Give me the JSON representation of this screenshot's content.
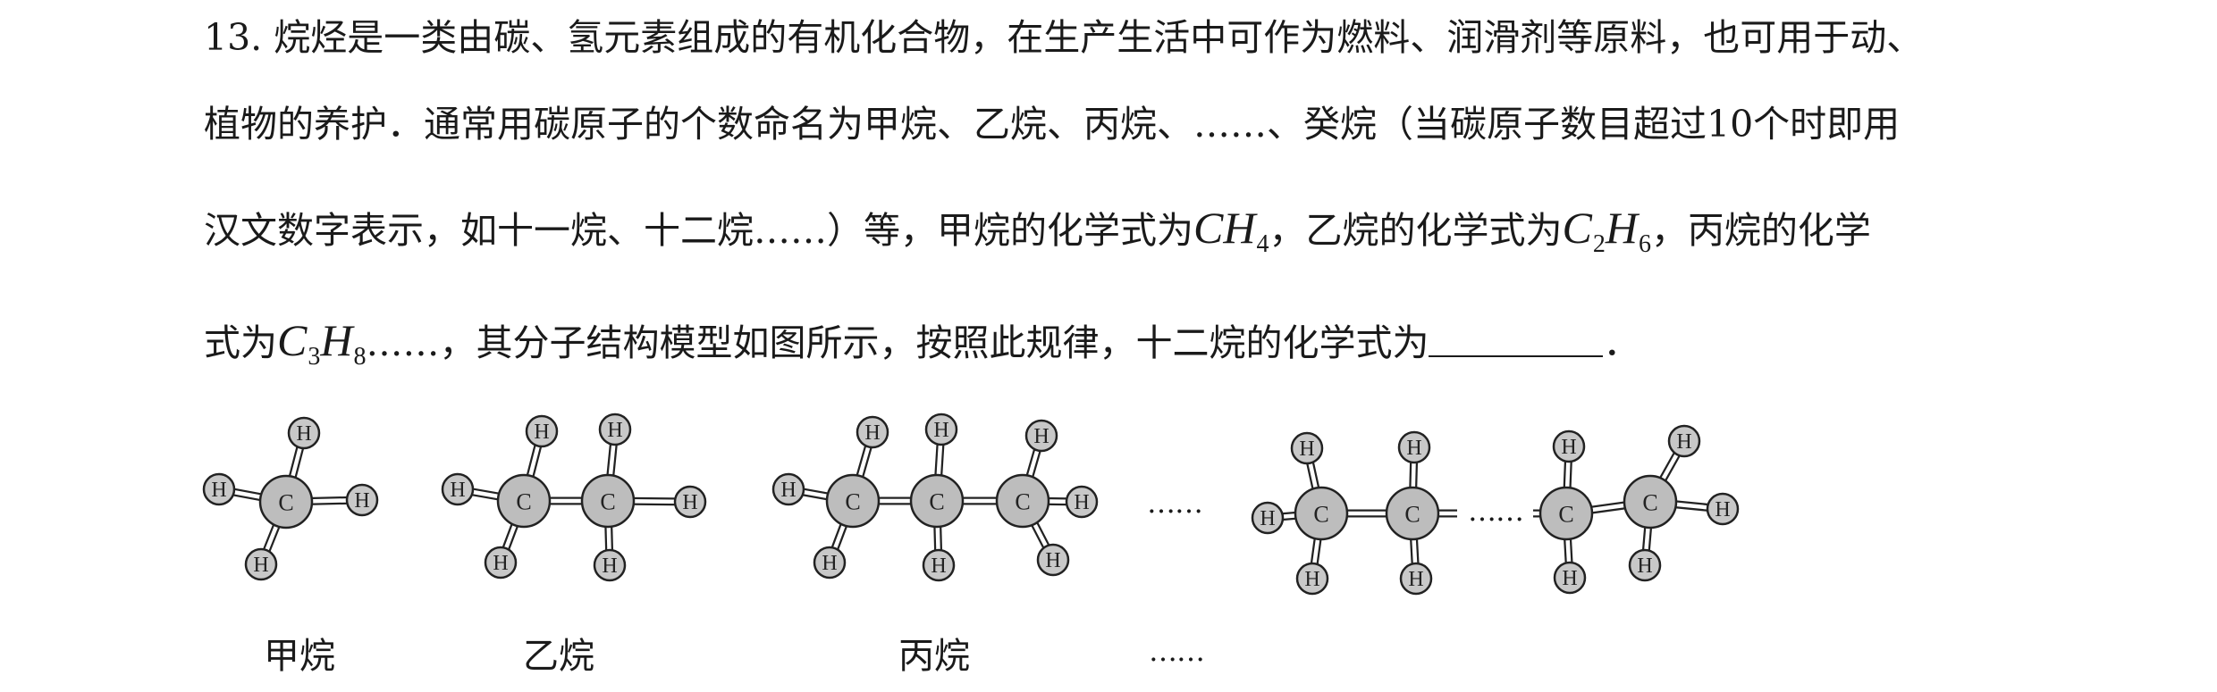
{
  "question": {
    "line1": "13. 烷烃是一类由碳、氢元素组成的有机化合物，在生产生活中可作为燃料、润滑剂等原料，也可用于动、",
    "line2": "植物的养护．通常用碳原子的个数命名为甲烷、乙烷、丙烷、……、癸烷（当碳原子数目超过10个时即用",
    "line3_a": "汉文数字表示，如十一烷、十二烷……）等，甲烷的化学式为",
    "line3_b": "，乙烷的化学式为",
    "line3_c": "，丙烷的化学",
    "line4_a": "式为",
    "line4_b": "……，其分子结构模型如图所示，按照此规律，十二烷的化学式为",
    "line4_c": "．"
  },
  "formulas": {
    "methane": {
      "base1": "CH",
      "sub1": "4"
    },
    "ethane": {
      "base1": "C",
      "sub1": "2",
      "base2": "H",
      "sub2": "6"
    },
    "propane": {
      "base1": "C",
      "sub1": "3",
      "base2": "H",
      "sub2": "8"
    }
  },
  "atoms": {
    "carbon": "C",
    "hydrogen": "H"
  },
  "figure": {
    "ellipsis_between": "……",
    "ellipsis_chain": "……",
    "labels": {
      "methane": "甲烷",
      "ethane": "乙烷",
      "propane": "丙烷",
      "ellipsis": "……"
    }
  }
}
